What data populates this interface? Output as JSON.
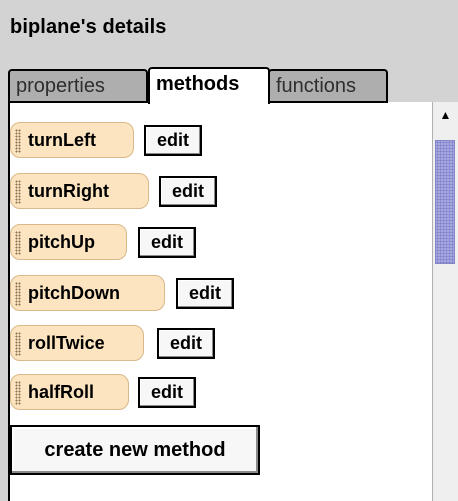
{
  "panel": {
    "title": "biplane's details"
  },
  "tabs": [
    {
      "label": "properties",
      "selected": false
    },
    {
      "label": "methods",
      "selected": true
    },
    {
      "label": "functions",
      "selected": false
    }
  ],
  "methods": [
    {
      "name": "turnLeft",
      "edit_label": "edit"
    },
    {
      "name": "turnRight",
      "edit_label": "edit"
    },
    {
      "name": "pitchUp",
      "edit_label": "edit"
    },
    {
      "name": "pitchDown",
      "edit_label": "edit"
    },
    {
      "name": "rollTwice",
      "edit_label": "edit"
    },
    {
      "name": "halfRoll",
      "edit_label": "edit"
    }
  ],
  "create_button": {
    "label": "create new method"
  },
  "scrollbar": {
    "up_icon": "arrow-up-icon"
  },
  "colors": {
    "panel_bg": "#d3d3d3",
    "method_pill": "#fbe4bf",
    "scroll_thumb": "#a7a9e2"
  }
}
